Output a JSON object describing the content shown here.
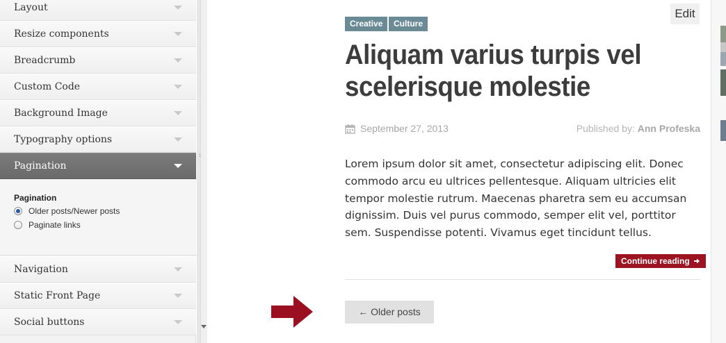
{
  "sidebar": {
    "sections": [
      {
        "label": "Layout",
        "active": false
      },
      {
        "label": "Resize components",
        "active": false
      },
      {
        "label": "Breadcrumb",
        "active": false
      },
      {
        "label": "Custom Code",
        "active": false
      },
      {
        "label": "Background Image",
        "active": false
      },
      {
        "label": "Typography options",
        "active": false
      },
      {
        "label": "Pagination",
        "active": true
      },
      {
        "label": "Navigation",
        "active": false
      },
      {
        "label": "Static Front Page",
        "active": false
      },
      {
        "label": "Social buttons",
        "active": false
      }
    ],
    "pagination_panel": {
      "title": "Pagination",
      "options": [
        {
          "label": "Older posts/Newer posts",
          "checked": true
        },
        {
          "label": "Paginate links",
          "checked": false
        }
      ]
    }
  },
  "post": {
    "tags": [
      "Creative",
      "Culture"
    ],
    "edit_label": "Edit",
    "title": "Aliquam varius turpis vel scelerisque molestie",
    "date": "September 27, 2013",
    "published_by_label": "Published by:",
    "author": "Ann Profeska",
    "excerpt": "Lorem ipsum dolor sit amet, consectetur adipiscing elit. Donec commodo arcu eu ultrices pellentesque. Aliquam ultricies elit tempor molestie rutrum. Maecenas pharetra sem eu accumsan dignissim. Duis vel purus commodo, semper elit vel, porttitor sem. Suspendisse potenti. Vivamus eget tincidunt tellus.",
    "continue_label": "Continue reading"
  },
  "pagination": {
    "older_label": "← Older posts"
  },
  "icons": {
    "calendar": "calendar-icon",
    "continue_arrow": "arrow-right-icon",
    "pointer_arrow": "red-arrow-icon"
  },
  "colors": {
    "tag_bg": "#6a8b96",
    "active_section_bg": "#6f6f6f",
    "continue_bg": "#9c1422",
    "pointer_arrow": "#9a1020"
  }
}
